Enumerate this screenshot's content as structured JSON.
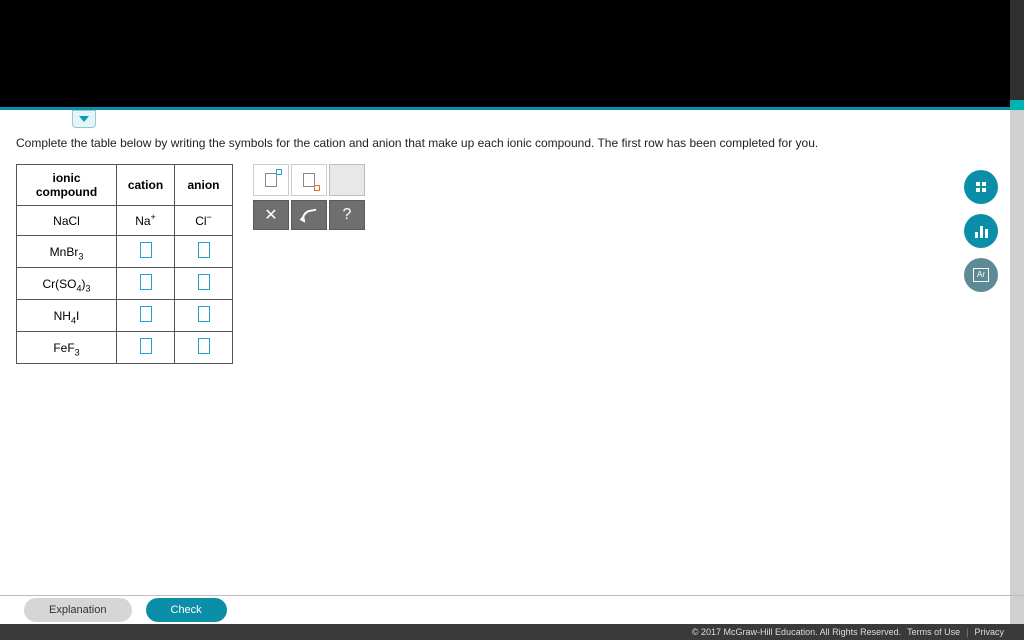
{
  "prompt": "Complete the table below by writing the symbols for the cation and anion that make up each ionic compound. The first row has been completed for you.",
  "table": {
    "headers": {
      "compound": "ionic compound",
      "cation": "cation",
      "anion": "anion"
    },
    "rows": [
      {
        "compound_html": "NaCl",
        "cation_html": "Na<sup>+</sup>",
        "anion_html": "Cl<sup>−</sup>",
        "filled": true
      },
      {
        "compound_html": "MnBr<sub>3</sub>",
        "filled": false
      },
      {
        "compound_html": "Cr(SO<sub>4</sub>)<sub>3</sub>",
        "filled": false
      },
      {
        "compound_html": "NH<sub>4</sub>I",
        "filled": false
      },
      {
        "compound_html": "FeF<sub>3</sub>",
        "filled": false
      }
    ]
  },
  "actions": {
    "reset_label": "✕",
    "help_label": "?"
  },
  "side": {
    "calc": "calc",
    "stats": "stats",
    "periodic": "Ar"
  },
  "footer": {
    "explanation": "Explanation",
    "check": "Check"
  },
  "legal": {
    "copyright": "© 2017 McGraw-Hill Education. All Rights Reserved.",
    "terms": "Terms of Use",
    "privacy": "Privacy"
  }
}
